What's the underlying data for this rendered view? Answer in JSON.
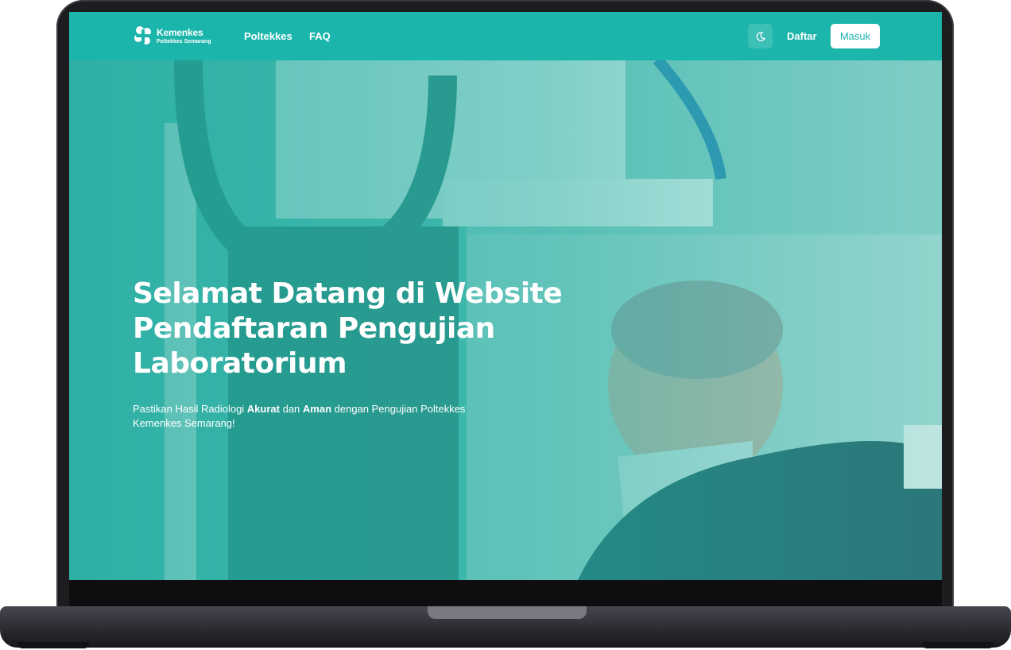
{
  "navbar": {
    "logo_title": "Kemenkes",
    "logo_subtitle": "Poltekkes Semarang",
    "links": [
      {
        "label": "Poltekkes"
      },
      {
        "label": "FAQ"
      }
    ],
    "theme_toggle_icon": "moon-icon",
    "register_label": "Daftar",
    "login_label": "Masuk"
  },
  "hero": {
    "title": "Selamat Datang di Website Pendaftaran Pengujian Laboratorium",
    "description": {
      "part1": "Pastikan Hasil Radiologi ",
      "bold1": "Akurat",
      "part2": " dan ",
      "bold2": "Aman",
      "part3": " dengan Pengujian Poltekkes Kemenkes Semarang!"
    }
  },
  "colors": {
    "primary": "#1bb5ac",
    "laptop_frame": "#1d1d20",
    "text_on_primary": "#ffffff"
  }
}
